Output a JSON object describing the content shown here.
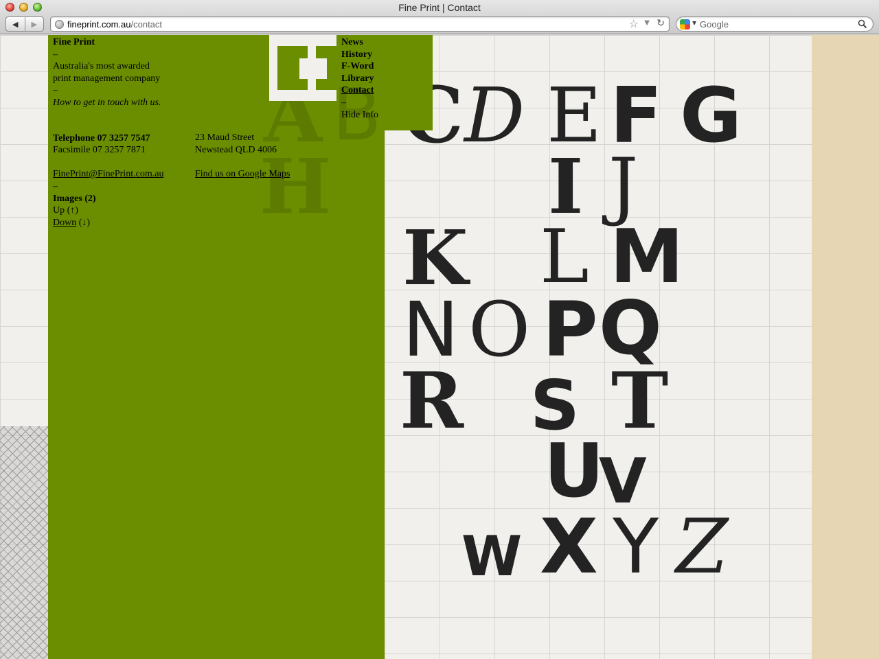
{
  "window": {
    "title": "Fine Print | Contact"
  },
  "toolbar": {
    "back_label": "◀",
    "forward_label": "▶",
    "url_host": "fineprint.com.au",
    "url_path": "/contact",
    "search_placeholder": "Google"
  },
  "site": {
    "name": "Fine Print",
    "dash": "–",
    "tagline_line1": "Australia's most awarded",
    "tagline_line2": "print management company",
    "subtitle": "How to get in touch with us.",
    "telephone": "Telephone 07 3257 7547",
    "facsimile": "Facsimile 07 3257 7871",
    "email": "FinePrint@FinePrint.com.au",
    "address_line1": "23 Maud Street",
    "address_line2": "Newstead QLD 4006",
    "maps_link": "Find us on Google Maps",
    "images_heading": "Images (2)",
    "up_label": "Up (↑)",
    "down_link": "Down",
    "down_arrow": " (↓)"
  },
  "nav": {
    "items": [
      {
        "label": "News"
      },
      {
        "label": "History"
      },
      {
        "label": "F-Word"
      },
      {
        "label": "Library"
      },
      {
        "label": "Contact"
      }
    ],
    "dash": "–",
    "hide_info": "Hide Info"
  },
  "colors": {
    "overlay_green": "#6b8e00",
    "wall": "#f1f0ec",
    "stripe": "#e6d6b3"
  }
}
